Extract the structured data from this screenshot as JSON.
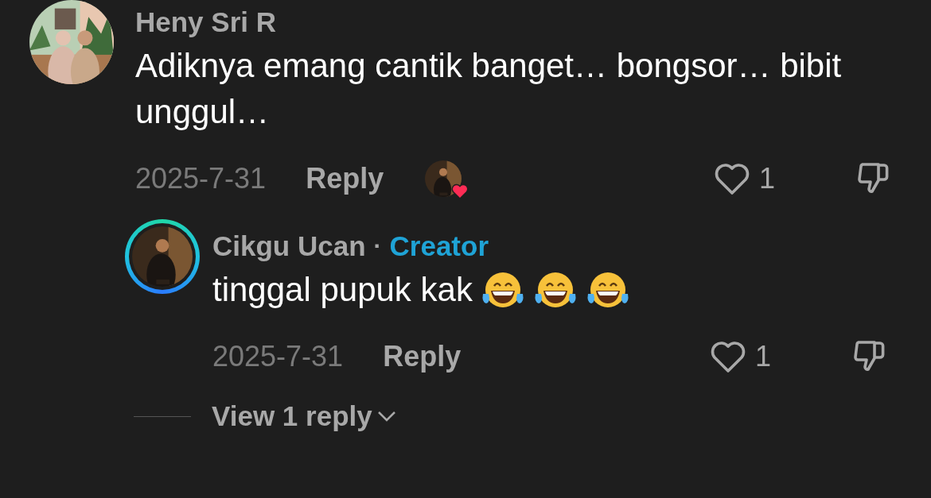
{
  "comments": [
    {
      "author": "Heny Sri R",
      "text": "Adiknya emang cantik banget… bongsor… bibit unggul…",
      "date": "2025-7-31",
      "reply_label": "Reply",
      "liked_by_creator": true,
      "liked": false,
      "likes": "1",
      "disliked": false,
      "replies": [
        {
          "author": "Cikgu Ucan",
          "separator": "·",
          "badge": "Creator",
          "text": "tinggal pupuk kak",
          "emojis": [
            {
              "kind": "tears-of-joy"
            },
            {
              "kind": "tears-of-joy"
            },
            {
              "kind": "tears-of-joy"
            }
          ],
          "date": "2025-7-31",
          "reply_label": "Reply",
          "liked": false,
          "likes": "1",
          "disliked": false
        }
      ],
      "view_replies": "View 1 reply"
    }
  ]
}
